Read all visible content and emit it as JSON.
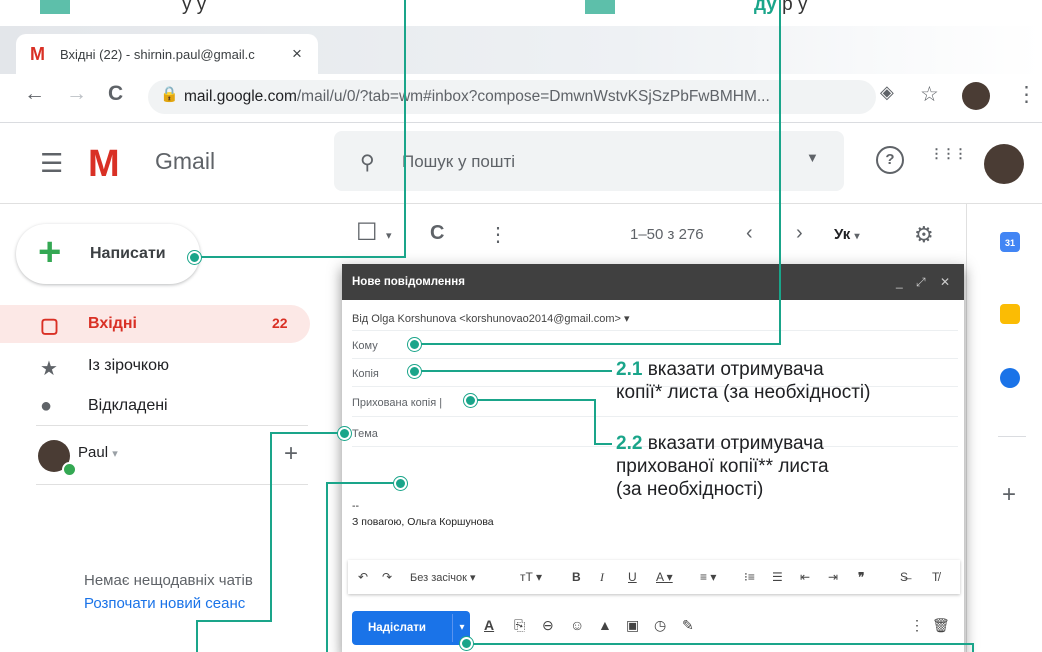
{
  "top_annotations": {
    "left_text": "у                  у",
    "right_text_green": "д",
    "right_text_green2": "у",
    "right_text_tail": "р      у"
  },
  "browser": {
    "tab_title": "Вхідні (22) - shirnin.paul@gmail.c",
    "tab_close": "×",
    "url_host": "mail.google.com",
    "url_path": "/mail/u/0/?tab=wm#inbox?compose=DmwnWstvKSjSzPbFwBMHM...",
    "back": "←",
    "forward": "→",
    "reload": "C",
    "lock": "🔒",
    "star": "☆",
    "menu": "⋮",
    "ext": "◈"
  },
  "gmail": {
    "logo": "M",
    "app_name": "Gmail",
    "search_placeholder": "Пошук у пошті",
    "help": "?",
    "apps": "⋮⋮⋮",
    "menu": "☰"
  },
  "nav": {
    "compose_label": "Написати",
    "items": [
      {
        "label": "Вхідні",
        "count": "22",
        "icon": "inbox-icon",
        "glyph": "▢",
        "color": "#d93025"
      },
      {
        "label": "Із зірочкою",
        "icon": "star-icon",
        "glyph": "★",
        "color": "#5f6368"
      },
      {
        "label": "Відкладені",
        "icon": "clock-icon",
        "glyph": "●",
        "color": "#5f6368"
      }
    ],
    "user_name": "Paul",
    "user_caret": "▾",
    "add": "+",
    "no_chats": "Немає нещодавніх чатів",
    "new_session": "Розпочати новий сеанс"
  },
  "list_toolbar": {
    "select_box": "☐",
    "caret": "▾",
    "refresh": "C",
    "more": "⋮",
    "pager": "1–50 з 276",
    "prev": "‹",
    "next": "›",
    "lang": "Ук",
    "lang_caret": "▾",
    "settings": "⚙"
  },
  "side_panel": {
    "calendar_label": "31",
    "plus": "+"
  },
  "compose_window": {
    "title": "Нове повідомлення",
    "minimize": "_",
    "expand": "⤢",
    "close": "✕",
    "from": "Від  Olga Korshunova <korshunovao2014@gmail.com>  ▾",
    "to": "Кому",
    "cc": "Копія",
    "bcc": "Прихована копія |",
    "subject": "Тема",
    "sig_dashes": "--",
    "signature": "З повагою, Ольга Коршунова",
    "font_label": "Без засічок ▾",
    "format_icons": [
      "↶",
      "↷",
      "тT ▾",
      "B",
      "I",
      "U",
      "A ▾",
      "≡ ▾",
      "⁝≡",
      "☰",
      "⇤",
      "⇥",
      "❞",
      "S̶",
      "T̸"
    ],
    "send_label": "Надіслати",
    "send_caret": "▾",
    "bottom_icons": [
      "A",
      "⎘",
      "⊖",
      "☺",
      "▲",
      "▣",
      "◷",
      "✎"
    ],
    "more": "⋮",
    "trash": "🗑"
  },
  "callouts": {
    "c21_num": "2.1",
    "c21_text1": "вказати отримувача",
    "c21_text2": "копії* листа (за необхідності)",
    "c22_num": "2.2",
    "c22_text1": "вказати отримувача",
    "c22_text2": "прихованої копії** листа",
    "c22_text3": "(за необхідності)"
  },
  "colors": {
    "accent_teal": "#1aa58a",
    "gmail_red": "#d93025",
    "send_blue": "#1a73e8"
  }
}
